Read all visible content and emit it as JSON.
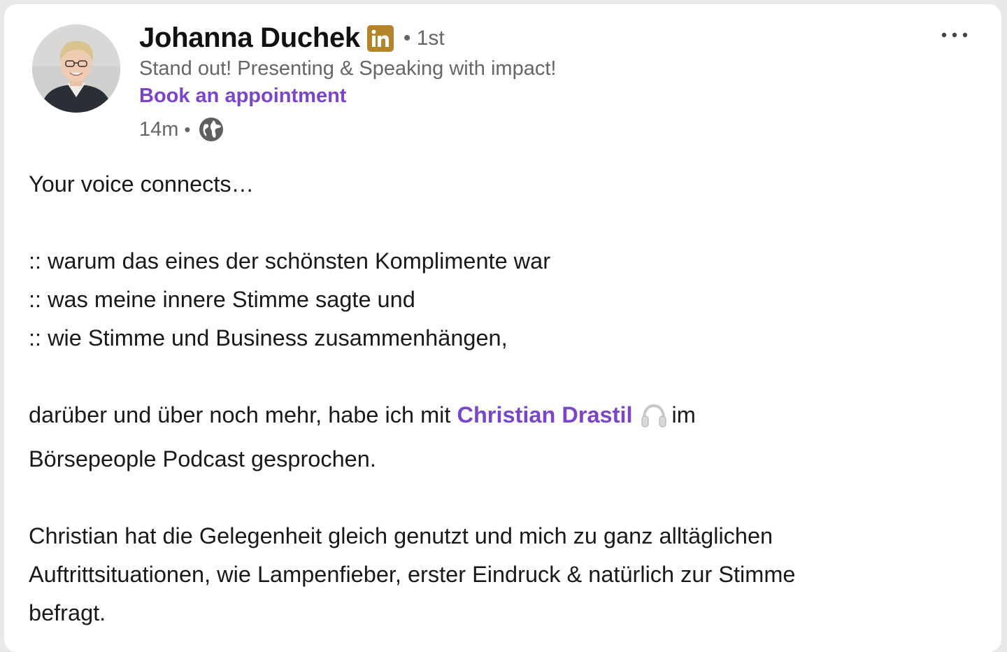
{
  "author": {
    "name": "Johanna Duchek",
    "degree": "• 1st",
    "headline": "Stand out! Presenting & Speaking with impact!",
    "cta": "Book an appointment",
    "time": "14m",
    "separator": "•",
    "avatar_icon": "profile-photo",
    "badge_icon": "linkedin-icon",
    "visibility_icon": "globe-icon"
  },
  "menu_icon": "more-options-icon",
  "post": {
    "line1": "Your voice connects…",
    "bullet1": ":: warum das eines der schönsten Komplimente war",
    "bullet2": ":: was meine innere Stimme sagte und",
    "bullet3": ":: wie Stimme und Business zusammenhängen,",
    "p2_before": "darüber und über noch mehr, habe ich mit ",
    "mention": "Christian Drastil",
    "mention_emoji": "headphones-icon",
    "p2_after": "im",
    "p2_line2": "Börsepeople Podcast gesprochen.",
    "p3_line1": "Christian hat die Gelegenheit gleich genutzt und mich zu ganz alltäglichen",
    "p3_line2": "Auftrittsituationen, wie Lampenfieber, erster Eindruck & natürlich zur Stimme",
    "p3_line3": "befragt."
  },
  "colors": {
    "link": "#7b45c9",
    "badge": "#b3842a",
    "muted": "#666666",
    "text": "#191919"
  }
}
